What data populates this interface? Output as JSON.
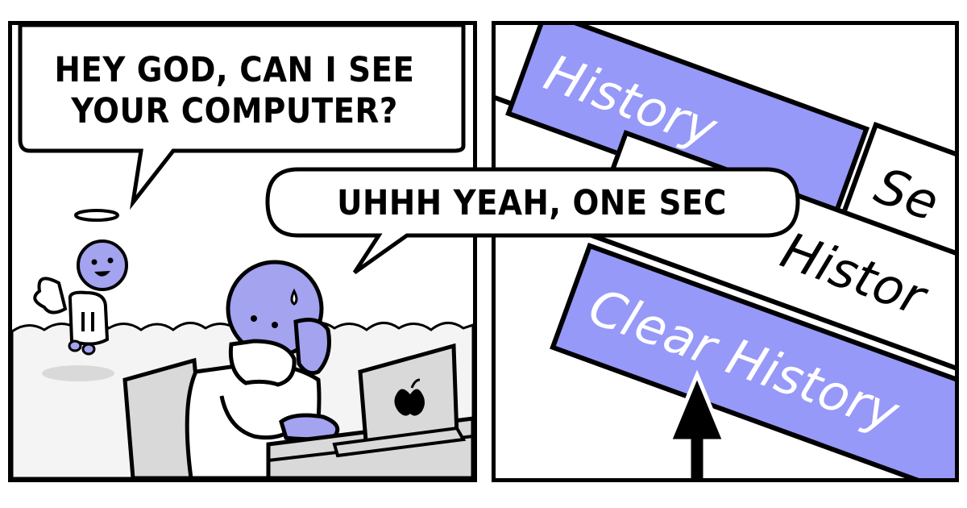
{
  "panel_left": {
    "speech_god": "HEY GOD, CAN I SEE\nYOUR COMPUTER?",
    "speech_reply": "UHHH YEAH, ONE SEC"
  },
  "panel_right": {
    "menu_items": {
      "history": "History",
      "search": "Se",
      "history_view": "Histor",
      "clear_history": "Clear History"
    }
  },
  "colors": {
    "accent_purple": "#9699f7",
    "character_purple": "#a3a3f0",
    "cloud_grey": "#f4f4f4",
    "shadow_grey": "#d9d9d9",
    "ink": "#000000"
  }
}
